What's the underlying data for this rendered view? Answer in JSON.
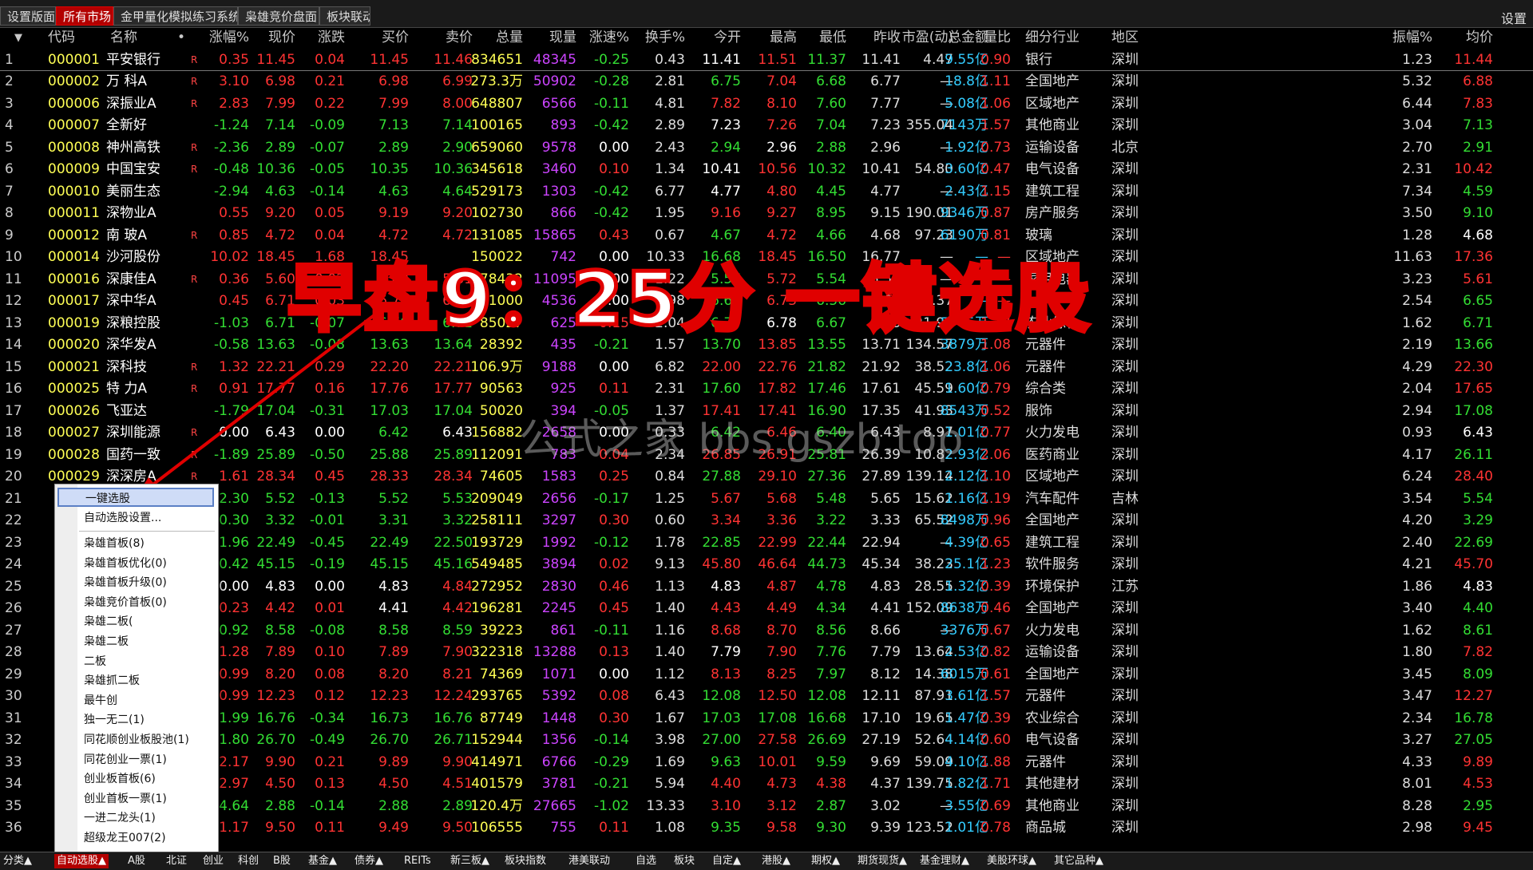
{
  "top_tabs": [
    {
      "label": "设置版面",
      "active": false
    },
    {
      "label": "所有市场",
      "active": true
    },
    {
      "label": "金甲量化模拟练习系统9.0",
      "active": false
    },
    {
      "label": "枭雄竞价盘面",
      "active": false
    },
    {
      "label": "板块联动",
      "active": false
    }
  ],
  "top_right": "设置",
  "columns": [
    "代码",
    "名称",
    "•",
    "涨幅%",
    "现价",
    "涨跌",
    "买价",
    "卖价",
    "总量",
    "现量",
    "涨速%",
    "换手%",
    "今开",
    "最高",
    "最低",
    "昨收",
    "市盈(动)",
    "总金额",
    "量比",
    "细分行业",
    "地区",
    "振幅%",
    "均价"
  ],
  "rows": [
    {
      "i": "1",
      "code": "000001",
      "name": "平安银行",
      "m": "R",
      "v": [
        "0.35",
        "11.45",
        "0.04",
        "11.45",
        "11.46",
        "834651",
        "48345",
        "-0.25",
        "0.43",
        "11.41",
        "11.51",
        "11.37",
        "11.41",
        "4.47",
        "9.55亿",
        "0.90",
        "银行",
        "深圳",
        "1.23",
        "11.44"
      ]
    },
    {
      "i": "2",
      "code": "000002",
      "name": "万 科A",
      "m": "R",
      "v": [
        "3.10",
        "6.98",
        "0.21",
        "6.98",
        "6.99",
        "273.3万",
        "50902",
        "-0.28",
        "2.81",
        "6.75",
        "7.04",
        "6.68",
        "6.77",
        "—",
        "18.8亿",
        "1.11",
        "全国地产",
        "深圳",
        "5.32",
        "6.88"
      ]
    },
    {
      "i": "3",
      "code": "000006",
      "name": "深振业A",
      "m": "R",
      "v": [
        "2.83",
        "7.99",
        "0.22",
        "7.99",
        "8.00",
        "648807",
        "6566",
        "-0.11",
        "4.81",
        "7.82",
        "8.10",
        "7.60",
        "7.77",
        "—",
        "5.08亿",
        "1.06",
        "区域地产",
        "深圳",
        "6.44",
        "7.83"
      ]
    },
    {
      "i": "4",
      "code": "000007",
      "name": "全新好",
      "m": "",
      "v": [
        "-1.24",
        "7.14",
        "-0.09",
        "7.13",
        "7.14",
        "100165",
        "893",
        "-0.42",
        "2.89",
        "7.23",
        "7.26",
        "7.04",
        "7.23",
        "355.04",
        "7143万",
        "1.57",
        "其他商业",
        "深圳",
        "3.04",
        "7.13"
      ]
    },
    {
      "i": "5",
      "code": "000008",
      "name": "神州高铁",
      "m": "R",
      "v": [
        "-2.36",
        "2.89",
        "-0.07",
        "2.89",
        "2.90",
        "659060",
        "9578",
        "0.00",
        "2.43",
        "2.94",
        "2.96",
        "2.88",
        "2.96",
        "—",
        "1.92亿",
        "0.73",
        "运输设备",
        "北京",
        "2.70",
        "2.91"
      ]
    },
    {
      "i": "6",
      "code": "000009",
      "name": "中国宝安",
      "m": "R",
      "v": [
        "-0.48",
        "10.36",
        "-0.05",
        "10.35",
        "10.36",
        "345618",
        "3460",
        "0.10",
        "1.34",
        "10.41",
        "10.56",
        "10.32",
        "10.41",
        "54.80",
        "3.60亿",
        "0.47",
        "电气设备",
        "深圳",
        "2.31",
        "10.42"
      ]
    },
    {
      "i": "7",
      "code": "000010",
      "name": "美丽生态",
      "m": "",
      "v": [
        "-2.94",
        "4.63",
        "-0.14",
        "4.63",
        "4.64",
        "529173",
        "1303",
        "-0.42",
        "6.77",
        "4.77",
        "4.80",
        "4.45",
        "4.77",
        "—",
        "2.43亿",
        "1.15",
        "建筑工程",
        "深圳",
        "7.34",
        "4.59"
      ]
    },
    {
      "i": "8",
      "code": "000011",
      "name": "深物业A",
      "m": "",
      "v": [
        "0.55",
        "9.20",
        "0.05",
        "9.19",
        "9.20",
        "102730",
        "866",
        "-0.42",
        "1.95",
        "9.16",
        "9.27",
        "8.95",
        "9.15",
        "190.01",
        "9346万",
        "0.87",
        "房产服务",
        "深圳",
        "3.50",
        "9.10"
      ]
    },
    {
      "i": "9",
      "code": "000012",
      "name": "南 玻A",
      "m": "R",
      "v": [
        "0.85",
        "4.72",
        "0.04",
        "4.72",
        "4.72",
        "131085",
        "15865",
        "0.43",
        "0.67",
        "4.67",
        "4.72",
        "4.66",
        "4.68",
        "97.23",
        "6190万",
        "0.81",
        "玻璃",
        "深圳",
        "1.28",
        "4.68"
      ]
    },
    {
      "i": "10",
      "code": "000014",
      "name": "沙河股份",
      "m": "",
      "v": [
        "10.02",
        "18.45",
        "1.68",
        "18.45",
        "",
        "150022",
        "742",
        "0.00",
        "10.33",
        "16.68",
        "18.45",
        "16.50",
        "16.77",
        "—",
        "—",
        "—",
        "区域地产",
        "深圳",
        "11.63",
        "17.36"
      ]
    },
    {
      "i": "11",
      "code": "000016",
      "name": "深康佳A",
      "m": "R",
      "v": [
        "0.36",
        "5.60",
        "0.02",
        "5.60",
        "5.61",
        "678432",
        "11095",
        "0.00",
        "1.22",
        "5.57",
        "5.72",
        "5.54",
        "5.58",
        "—",
        "—",
        "—",
        "家用电器",
        "深圳",
        "3.23",
        "5.61"
      ]
    },
    {
      "i": "12",
      "code": "000017",
      "name": "深中华A",
      "m": "",
      "v": [
        "0.45",
        "6.71",
        "0.03",
        "6.71",
        "6.72",
        "181000",
        "4536",
        "0.00",
        "1.98",
        "6.66",
        "6.73",
        "6.56",
        "6.68",
        "124.37",
        "—",
        "—",
        "—",
        "深圳",
        "2.54",
        "6.65"
      ]
    },
    {
      "i": "13",
      "code": "000019",
      "name": "深粮控股",
      "m": "",
      "v": [
        "-1.03",
        "6.71",
        "-0.07",
        "6.70",
        "6.71",
        "85027",
        "625",
        "0.15",
        "2.04",
        "6.77",
        "6.78",
        "6.67",
        "6.78",
        "21.97",
        "5705万",
        "1.17",
        "农业综合",
        "深圳",
        "1.62",
        "6.71"
      ]
    },
    {
      "i": "14",
      "code": "000020",
      "name": "深华发A",
      "m": "",
      "v": [
        "-0.58",
        "13.63",
        "-0.08",
        "13.63",
        "13.64",
        "28392",
        "435",
        "-0.21",
        "1.57",
        "13.70",
        "13.85",
        "13.55",
        "13.71",
        "134.57",
        "3879万",
        "1.08",
        "元器件",
        "深圳",
        "2.19",
        "13.66"
      ]
    },
    {
      "i": "15",
      "code": "000021",
      "name": "深科技",
      "m": "R",
      "v": [
        "1.32",
        "22.21",
        "0.29",
        "22.20",
        "22.21",
        "106.9万",
        "9188",
        "0.00",
        "6.82",
        "22.00",
        "22.76",
        "21.82",
        "21.92",
        "38.52",
        "23.8亿",
        "1.06",
        "元器件",
        "深圳",
        "4.29",
        "22.30"
      ]
    },
    {
      "i": "16",
      "code": "000025",
      "name": "特 力A",
      "m": "R",
      "v": [
        "0.91",
        "17.77",
        "0.16",
        "17.76",
        "17.77",
        "90563",
        "925",
        "0.11",
        "2.31",
        "17.60",
        "17.82",
        "17.46",
        "17.61",
        "45.59",
        "1.60亿",
        "0.79",
        "综合类",
        "深圳",
        "2.04",
        "17.65"
      ]
    },
    {
      "i": "17",
      "code": "000026",
      "name": "飞亚达",
      "m": "",
      "v": [
        "-1.79",
        "17.04",
        "-0.31",
        "17.03",
        "17.04",
        "50020",
        "394",
        "-0.05",
        "1.37",
        "17.41",
        "17.41",
        "16.90",
        "17.35",
        "41.93",
        "8543万",
        "0.52",
        "服饰",
        "深圳",
        "2.94",
        "17.08"
      ]
    },
    {
      "i": "18",
      "code": "000027",
      "name": "深圳能源",
      "m": "R",
      "v": [
        "0.00",
        "6.43",
        "0.00",
        "6.42",
        "6.43",
        "156882",
        "2658",
        "0.00",
        "0.33",
        "6.42",
        "6.46",
        "6.40",
        "6.43",
        "8.97",
        "1.01亿",
        "0.77",
        "火力发电",
        "深圳",
        "0.93",
        "6.43"
      ]
    },
    {
      "i": "19",
      "code": "000028",
      "name": "国药一致",
      "m": "R",
      "v": [
        "-1.89",
        "25.89",
        "-0.50",
        "25.88",
        "25.89",
        "112091",
        "783",
        "0.04",
        "2.34",
        "26.85",
        "26.91",
        "25.81",
        "26.39",
        "10.82",
        "2.93亿",
        "2.06",
        "医药商业",
        "深圳",
        "4.17",
        "26.11"
      ]
    },
    {
      "i": "20",
      "code": "000029",
      "name": "深深房A",
      "m": "R",
      "v": [
        "1.61",
        "28.34",
        "0.45",
        "28.33",
        "28.34",
        "74605",
        "1583",
        "0.25",
        "0.84",
        "27.88",
        "29.10",
        "27.36",
        "27.89",
        "139.14",
        "2.12亿",
        "1.10",
        "区域地产",
        "深圳",
        "6.24",
        "28.40"
      ]
    },
    {
      "i": "21",
      "code": "",
      "name": "",
      "m": "",
      "v": [
        "-2.30",
        "5.52",
        "-0.13",
        "5.52",
        "5.53",
        "209049",
        "2656",
        "-0.17",
        "1.25",
        "5.67",
        "5.68",
        "5.48",
        "5.65",
        "15.62",
        "1.16亿",
        "1.19",
        "汽车配件",
        "吉林",
        "3.54",
        "5.54"
      ]
    },
    {
      "i": "22",
      "code": "",
      "name": "",
      "m": "",
      "v": [
        "-0.30",
        "3.32",
        "-0.01",
        "3.31",
        "3.32",
        "258111",
        "3297",
        "0.30",
        "0.60",
        "3.34",
        "3.36",
        "3.22",
        "3.33",
        "65.52",
        "8498万",
        "0.96",
        "全国地产",
        "深圳",
        "4.20",
        "3.29"
      ]
    },
    {
      "i": "23",
      "code": "",
      "name": "",
      "m": "",
      "v": [
        "-1.96",
        "22.49",
        "-0.45",
        "22.49",
        "22.50",
        "193729",
        "1992",
        "-0.12",
        "1.78",
        "22.85",
        "22.99",
        "22.44",
        "22.94",
        "—",
        "4.39亿",
        "0.65",
        "建筑工程",
        "深圳",
        "2.40",
        "22.69"
      ]
    },
    {
      "i": "24",
      "code": "",
      "name": "",
      "m": "",
      "v": [
        "-0.42",
        "45.15",
        "-0.19",
        "45.15",
        "45.16",
        "549485",
        "3894",
        "0.02",
        "9.13",
        "45.80",
        "46.64",
        "44.73",
        "45.34",
        "38.23",
        "25.1亿",
        "1.23",
        "软件服务",
        "深圳",
        "4.21",
        "45.70"
      ]
    },
    {
      "i": "25",
      "code": "",
      "name": "",
      "m": "",
      "v": [
        "0.00",
        "4.83",
        "0.00",
        "4.83",
        "4.84",
        "272952",
        "2830",
        "0.46",
        "1.13",
        "4.83",
        "4.87",
        "4.78",
        "4.83",
        "28.55",
        "1.32亿",
        "0.39",
        "环境保护",
        "江苏",
        "1.86",
        "4.83"
      ]
    },
    {
      "i": "26",
      "code": "",
      "name": "",
      "m": "",
      "v": [
        "0.23",
        "4.42",
        "0.01",
        "4.41",
        "4.42",
        "196281",
        "2245",
        "0.45",
        "1.40",
        "4.43",
        "4.49",
        "4.34",
        "4.41",
        "152.09",
        "8638万",
        "0.46",
        "全国地产",
        "深圳",
        "3.40",
        "4.40"
      ]
    },
    {
      "i": "27",
      "code": "",
      "name": "",
      "m": "",
      "v": [
        "-0.92",
        "8.58",
        "-0.08",
        "8.58",
        "8.59",
        "39223",
        "861",
        "-0.11",
        "1.16",
        "8.68",
        "8.70",
        "8.56",
        "8.66",
        "—",
        "3376万",
        "0.67",
        "火力发电",
        "深圳",
        "1.62",
        "8.61"
      ]
    },
    {
      "i": "28",
      "code": "",
      "name": "",
      "m": "",
      "v": [
        "1.28",
        "7.89",
        "0.10",
        "7.89",
        "7.90",
        "322318",
        "13288",
        "0.13",
        "1.40",
        "7.79",
        "7.90",
        "7.76",
        "7.79",
        "13.64",
        "2.53亿",
        "0.82",
        "运输设备",
        "深圳",
        "1.80",
        "7.82"
      ]
    },
    {
      "i": "29",
      "code": "",
      "name": "",
      "m": "",
      "v": [
        "0.99",
        "8.20",
        "0.08",
        "8.20",
        "8.21",
        "74369",
        "1071",
        "0.00",
        "1.12",
        "8.13",
        "8.25",
        "7.97",
        "8.12",
        "14.38",
        "6015万",
        "0.61",
        "全国地产",
        "深圳",
        "3.45",
        "8.09"
      ]
    },
    {
      "i": "30",
      "code": "",
      "name": "",
      "m": "",
      "v": [
        "0.99",
        "12.23",
        "0.12",
        "12.23",
        "12.24",
        "293765",
        "5392",
        "0.08",
        "6.43",
        "12.08",
        "12.50",
        "12.08",
        "12.11",
        "87.91",
        "3.61亿",
        "1.57",
        "元器件",
        "深圳",
        "3.47",
        "12.27"
      ]
    },
    {
      "i": "31",
      "code": "",
      "name": "",
      "m": "",
      "v": [
        "-1.99",
        "16.76",
        "-0.34",
        "16.73",
        "16.76",
        "87749",
        "1448",
        "0.30",
        "1.67",
        "17.03",
        "17.08",
        "16.68",
        "17.10",
        "19.65",
        "1.47亿",
        "0.39",
        "农业综合",
        "深圳",
        "2.34",
        "16.78"
      ]
    },
    {
      "i": "32",
      "code": "",
      "name": "",
      "m": "",
      "v": [
        "-1.80",
        "26.70",
        "-0.49",
        "26.70",
        "26.71",
        "152944",
        "1356",
        "-0.14",
        "3.98",
        "27.00",
        "27.58",
        "26.69",
        "27.19",
        "52.64",
        "4.14亿",
        "0.60",
        "电气设备",
        "深圳",
        "3.27",
        "27.05"
      ]
    },
    {
      "i": "33",
      "code": "",
      "name": "",
      "m": "",
      "v": [
        "2.17",
        "9.90",
        "0.21",
        "9.89",
        "9.90",
        "414971",
        "6766",
        "-0.29",
        "1.69",
        "9.63",
        "10.01",
        "9.59",
        "9.69",
        "59.09",
        "4.10亿",
        "1.88",
        "元器件",
        "深圳",
        "4.33",
        "9.89"
      ]
    },
    {
      "i": "34",
      "code": "",
      "name": "",
      "m": "",
      "v": [
        "2.97",
        "4.50",
        "0.13",
        "4.50",
        "4.51",
        "401579",
        "3781",
        "-0.21",
        "5.94",
        "4.40",
        "4.73",
        "4.38",
        "4.37",
        "139.75",
        "1.82亿",
        "1.71",
        "其他建材",
        "深圳",
        "8.01",
        "4.53"
      ]
    },
    {
      "i": "35",
      "code": "",
      "name": "",
      "m": "",
      "v": [
        "-4.64",
        "2.88",
        "-0.14",
        "2.88",
        "2.89",
        "120.4万",
        "27665",
        "-1.02",
        "13.33",
        "3.10",
        "3.12",
        "2.87",
        "3.02",
        "—",
        "3.55亿",
        "0.69",
        "其他商业",
        "深圳",
        "8.28",
        "2.95"
      ]
    },
    {
      "i": "36",
      "code": "",
      "name": "",
      "m": "",
      "v": [
        "1.17",
        "9.50",
        "0.11",
        "9.49",
        "9.50",
        "106555",
        "755",
        "0.11",
        "1.08",
        "9.35",
        "9.58",
        "9.30",
        "9.39",
        "123.52",
        "1.01亿",
        "0.78",
        "商品城",
        "深圳",
        "2.98",
        "9.45"
      ]
    }
  ],
  "context_menu": {
    "selected": "一键选股",
    "items": [
      "自动选股设置...",
      "枭雄首板(8)",
      "枭雄首板优化(0)",
      "枭雄首板升级(0)",
      "枭雄竞价首板(0)",
      "枭雄二板(",
      "枭雄二板",
      "二板",
      "枭雄抓二板",
      "最牛创",
      "独一无二(1)",
      "同花顺创业板股池(1)",
      "同花创业一票(1)",
      "创业板首板(6)",
      "创业首板一票(1)",
      "一进二龙头(1)",
      "超级龙王007(2)"
    ]
  },
  "bottom_tabs": [
    {
      "label": "分类▲",
      "active": false
    },
    {
      "label": "自动选股▲",
      "active": true
    },
    {
      "label": "A股",
      "active": false
    },
    {
      "label": "北证",
      "active": false
    },
    {
      "label": "创业",
      "active": false
    },
    {
      "label": "科创",
      "active": false
    },
    {
      "label": "B股",
      "active": false
    },
    {
      "label": "基金▲",
      "active": false
    },
    {
      "label": "债券▲",
      "active": false
    },
    {
      "label": "REITs",
      "active": false
    },
    {
      "label": "新三板▲",
      "active": false
    },
    {
      "label": "板块指数",
      "active": false
    },
    {
      "label": "港美联动",
      "active": false
    },
    {
      "label": "自选",
      "active": false
    },
    {
      "label": "板块",
      "active": false
    },
    {
      "label": "自定▲",
      "active": false
    },
    {
      "label": "港股▲",
      "active": false
    },
    {
      "label": "期权▲",
      "active": false
    },
    {
      "label": "期货现货▲",
      "active": false
    },
    {
      "label": "基金理财▲",
      "active": false
    },
    {
      "label": "美股环球▲",
      "active": false
    },
    {
      "label": "其它品种▲",
      "active": false
    }
  ],
  "overlay_title": "早盘9：25分 一键选股",
  "watermark": "公式之家 bbs.gszb.top",
  "colors": {
    "up": "#ff3333",
    "down": "#33dd33",
    "neutral": "#ffffff",
    "volume": "#ffff55",
    "curvol": "#cc44ff",
    "amount": "#33ccff",
    "accent": "#b30000"
  }
}
